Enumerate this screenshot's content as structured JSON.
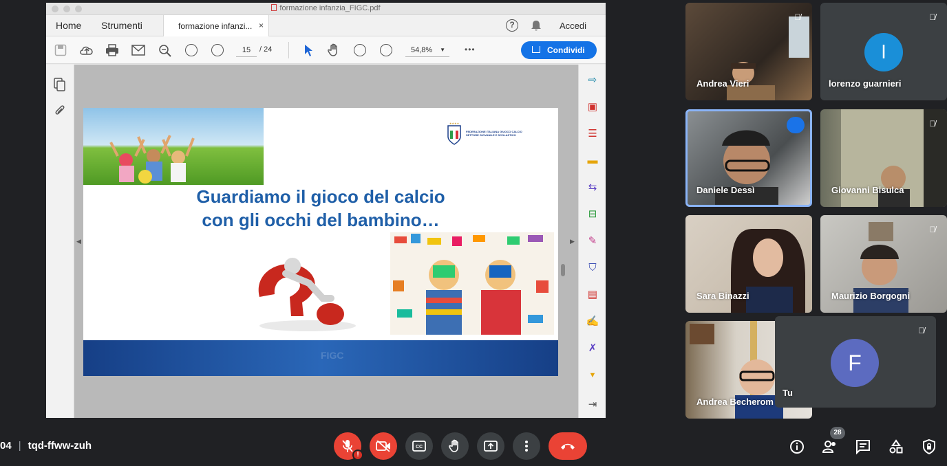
{
  "pdf": {
    "doc_title": "formazione infanzia_FIGC.pdf",
    "tabs": {
      "home": "Home",
      "tools": "Strumenti",
      "doc_tab": "formazione infanzi...",
      "close": "×"
    },
    "top_right": {
      "help": "?",
      "sign_in": "Accedi"
    },
    "toolbar": {
      "page_current": "15",
      "page_total": "/ 24",
      "zoom": "54,8%",
      "more": "•••",
      "share": "Condividi"
    },
    "slide": {
      "title_line1": "Guardiamo il gioco del calcio",
      "title_line2": "con gli occhi del bambino…",
      "logo_text": "FEDERAZIONE ITALIANA GIUOCO CALCIO SETTORE GIOVANILE E SCOLASTICO",
      "band_text": "FIGC"
    }
  },
  "participants": [
    {
      "name": "Andrea Vieri",
      "muted": true
    },
    {
      "name": "lorenzo guarnieri",
      "muted": true,
      "avatar_letter": "l",
      "avatar_color": "#1a8fd8"
    },
    {
      "name": "Daniele Dessì",
      "muted": false,
      "speaking": true
    },
    {
      "name": "Giovanni Bisulca",
      "muted": true
    },
    {
      "name": "Sara Binazzi",
      "muted": false
    },
    {
      "name": "Maurizio Borgogni",
      "muted": true
    },
    {
      "name": "Andrea Becherom",
      "muted": false
    },
    {
      "name": "Tu",
      "muted": true,
      "avatar_letter": "F",
      "avatar_color": "#5c6bc0"
    }
  ],
  "meeting": {
    "time_fragment": "04",
    "code": "tqd-ffww-zuh",
    "people_count": "28",
    "alert": "!"
  },
  "colors": {
    "accent": "#1473e6",
    "end_call": "#ea4335",
    "speaking_border": "#8ab4f8",
    "slide_title": "#1f5fa8"
  }
}
